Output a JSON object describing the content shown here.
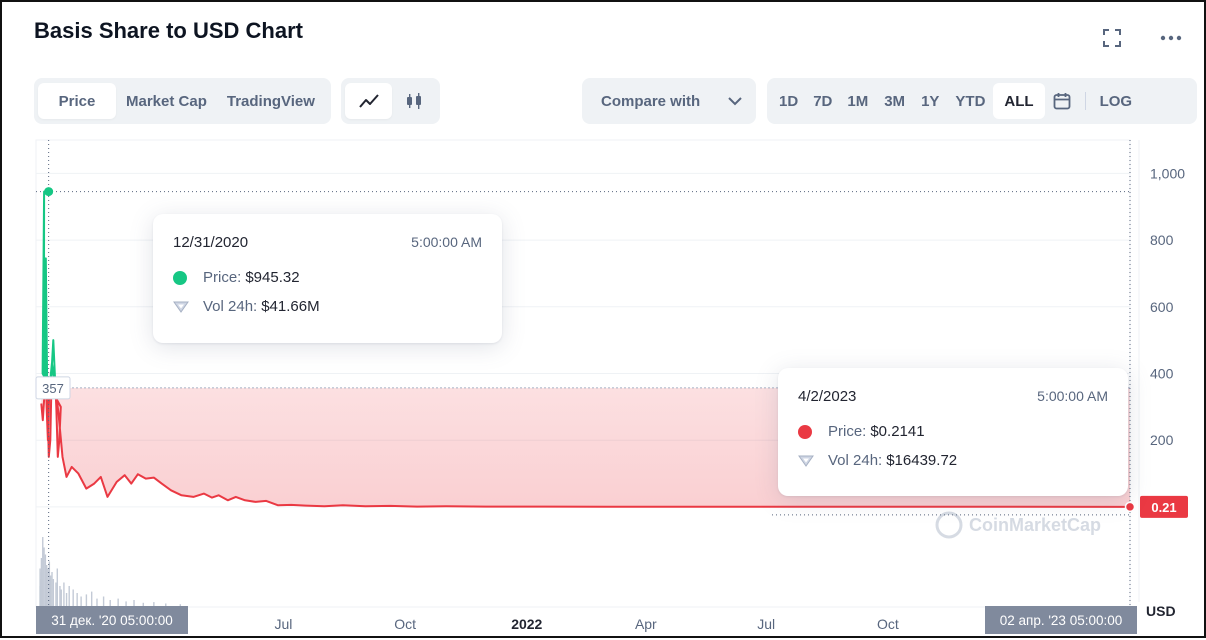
{
  "header": {
    "title": "Basis Share to USD Chart"
  },
  "tabs": [
    "Price",
    "Market Cap",
    "TradingView"
  ],
  "compare": {
    "label": "Compare with"
  },
  "ranges": [
    "1D",
    "7D",
    "1M",
    "3M",
    "1Y",
    "YTD",
    "ALL"
  ],
  "log_label": "LOG",
  "tooltip_left": {
    "date": "12/31/2020",
    "time": "5:00:00 AM",
    "price_label": "Price:",
    "price_value": "$945.32",
    "vol_label": "Vol 24h:",
    "vol_value": "$41.66M"
  },
  "tooltip_right": {
    "date": "4/2/2023",
    "time": "5:00:00 AM",
    "price_label": "Price:",
    "price_value": "$0.2141",
    "vol_label": "Vol 24h:",
    "vol_value": "$16439.72"
  },
  "colors": {
    "up": "#16c784",
    "down": "#ea3943",
    "axis_text": "#58667e",
    "grid": "#eff2f5",
    "label_bg": "#808a9d"
  },
  "chart_data": {
    "type": "line",
    "title": "Basis Share to USD Chart",
    "ylabel": "USD",
    "ylim": [
      -300,
      1100
    ],
    "yticks": [
      200,
      400,
      600,
      800,
      "1,000"
    ],
    "x_tick_labels": [
      "Jul",
      "Oct",
      "2022",
      "Apr",
      "Jul",
      "Oct"
    ],
    "x_tick_dates": [
      "2021-07-01",
      "2021-10-01",
      "2022-01-01",
      "2022-04-01",
      "2022-07-01",
      "2022-10-01"
    ],
    "baseline_value": 357,
    "baseline_label": "357",
    "last_value_label": "0.21",
    "crosshair_left_label": "31 дек. '20   05:00:00",
    "crosshair_right_label": "02 апр. '23   05:00:00",
    "watermark": "CoinMarketCap",
    "series": [
      {
        "name": "Price",
        "points": [
          [
            "2020-12-30",
            310
          ],
          [
            "2020-12-30",
            260
          ],
          [
            "2020-12-30",
            330
          ],
          [
            "2020-12-30",
            745
          ],
          [
            "2020-12-30",
            330
          ],
          [
            "2020-12-30",
            150
          ],
          [
            "2020-12-30",
            200
          ],
          [
            "2020-12-30",
            420
          ],
          [
            "2020-12-30",
            500
          ],
          [
            "2020-12-30",
            400
          ],
          [
            "2020-12-30",
            300
          ],
          [
            "2020-12-30",
            150
          ],
          [
            "2020-12-30",
            200
          ],
          [
            "2020-12-30",
            300
          ],
          [
            "2020-12-31",
            400
          ],
          [
            "2020-12-31",
            945.32
          ],
          [
            "2021-01-01",
            650
          ],
          [
            "2021-01-02",
            450
          ],
          [
            "2021-01-03",
            300
          ],
          [
            "2021-01-04",
            200
          ],
          [
            "2021-01-05",
            350
          ],
          [
            "2021-01-07",
            430
          ],
          [
            "2021-01-09",
            380
          ],
          [
            "2021-01-12",
            280
          ],
          [
            "2021-01-15",
            150
          ],
          [
            "2021-01-18",
            90
          ],
          [
            "2021-01-22",
            120
          ],
          [
            "2021-01-27",
            100
          ],
          [
            "2021-02-02",
            55
          ],
          [
            "2021-02-08",
            70
          ],
          [
            "2021-02-13",
            90
          ],
          [
            "2021-02-18",
            30
          ],
          [
            "2021-02-25",
            75
          ],
          [
            "2021-03-03",
            95
          ],
          [
            "2021-03-08",
            70
          ],
          [
            "2021-03-13",
            98
          ],
          [
            "2021-03-19",
            85
          ],
          [
            "2021-03-25",
            88
          ],
          [
            "2021-03-31",
            70
          ],
          [
            "2021-04-07",
            50
          ],
          [
            "2021-04-15",
            35
          ],
          [
            "2021-04-24",
            30
          ],
          [
            "2021-05-02",
            40
          ],
          [
            "2021-05-08",
            28
          ],
          [
            "2021-05-13",
            35
          ],
          [
            "2021-05-20",
            20
          ],
          [
            "2021-05-26",
            30
          ],
          [
            "2021-06-02",
            20
          ],
          [
            "2021-06-10",
            15
          ],
          [
            "2021-06-18",
            18
          ],
          [
            "2021-06-27",
            5
          ],
          [
            "2021-07-07",
            6
          ],
          [
            "2021-07-18",
            4
          ],
          [
            "2021-08-01",
            2
          ],
          [
            "2021-08-15",
            5
          ],
          [
            "2021-09-01",
            2
          ],
          [
            "2021-09-20",
            3
          ],
          [
            "2021-10-10",
            1
          ],
          [
            "2021-11-01",
            2
          ],
          [
            "2021-12-01",
            1
          ],
          [
            "2022-01-15",
            1
          ],
          [
            "2022-03-01",
            0.5
          ],
          [
            "2022-05-01",
            0.6
          ],
          [
            "2022-07-01",
            0.4
          ],
          [
            "2022-09-01",
            0.3
          ],
          [
            "2022-11-01",
            0.3
          ],
          [
            "2023-01-01",
            0.25
          ],
          [
            "2023-04-02",
            0.2141
          ]
        ]
      }
    ],
    "highlights": [
      {
        "date": "2020-12-31",
        "value": 945.32
      },
      {
        "date": "2023-04-02",
        "value": 0.2141
      }
    ],
    "volume": [
      [
        "2020-12-29",
        0.3
      ],
      [
        "2020-12-29",
        0.55
      ],
      [
        "2020-12-30",
        0.4
      ],
      [
        "2020-12-30",
        0.7
      ],
      [
        "2020-12-30",
        0.35
      ],
      [
        "2020-12-30",
        0.5
      ],
      [
        "2020-12-31",
        1.0
      ],
      [
        "2021-01-01",
        0.85
      ],
      [
        "2021-01-02",
        0.75
      ],
      [
        "2021-01-03",
        0.6
      ],
      [
        "2021-01-04",
        0.55
      ],
      [
        "2021-01-05",
        0.65
      ],
      [
        "2021-01-06",
        0.45
      ],
      [
        "2021-01-07",
        0.5
      ],
      [
        "2021-01-08",
        0.4
      ],
      [
        "2021-01-10",
        0.35
      ],
      [
        "2021-01-11",
        0.55
      ],
      [
        "2021-01-13",
        0.3
      ],
      [
        "2021-01-14",
        0.25
      ],
      [
        "2021-01-16",
        0.35
      ],
      [
        "2021-01-18",
        0.2
      ],
      [
        "2021-01-20",
        0.3
      ],
      [
        "2021-01-23",
        0.25
      ],
      [
        "2021-01-26",
        0.2
      ],
      [
        "2021-01-29",
        0.15
      ],
      [
        "2021-02-02",
        0.18
      ],
      [
        "2021-02-06",
        0.22
      ],
      [
        "2021-02-10",
        0.12
      ],
      [
        "2021-02-15",
        0.15
      ],
      [
        "2021-02-20",
        0.1
      ],
      [
        "2021-02-26",
        0.12
      ],
      [
        "2021-03-04",
        0.08
      ],
      [
        "2021-03-10",
        0.1
      ],
      [
        "2021-03-17",
        0.06
      ],
      [
        "2021-03-25",
        0.07
      ],
      [
        "2021-04-03",
        0.05
      ],
      [
        "2021-04-14",
        0.04
      ]
    ]
  }
}
